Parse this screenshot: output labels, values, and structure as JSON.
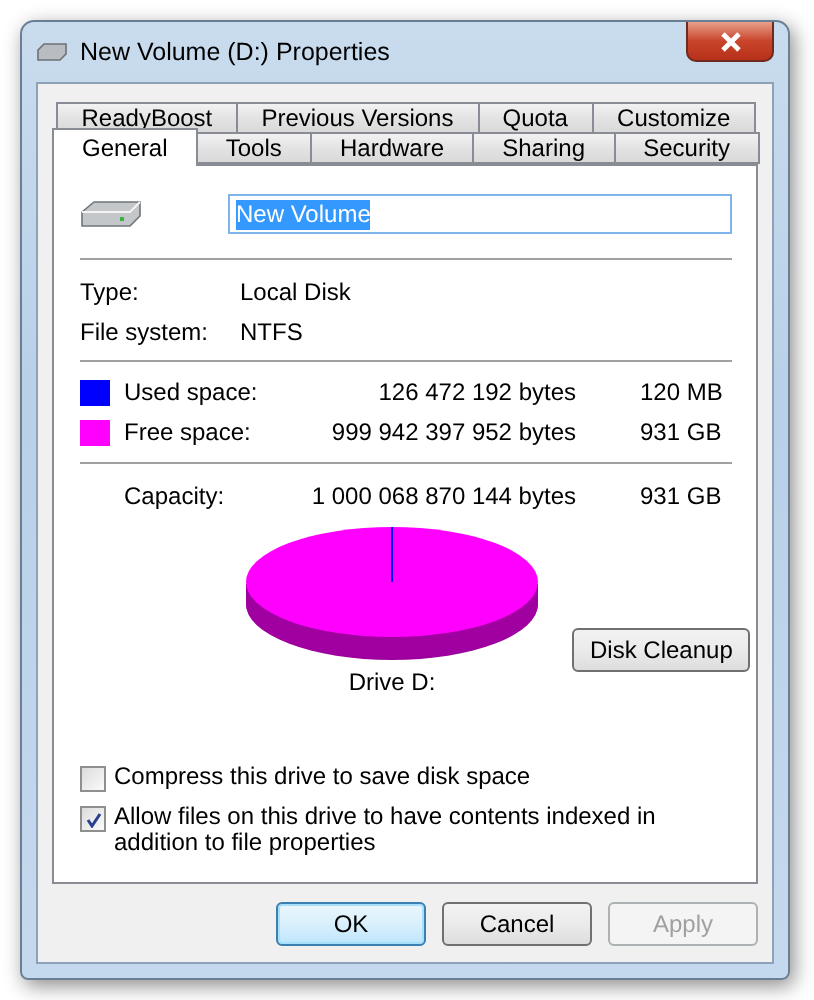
{
  "window": {
    "title": "New Volume (D:) Properties"
  },
  "tab_rows": [
    [
      {
        "label": "ReadyBoost",
        "selected": false
      },
      {
        "label": "Previous Versions",
        "selected": false
      },
      {
        "label": "Quota",
        "selected": false
      },
      {
        "label": "Customize",
        "selected": false
      }
    ],
    [
      {
        "label": "General",
        "selected": true
      },
      {
        "label": "Tools",
        "selected": false
      },
      {
        "label": "Hardware",
        "selected": false
      },
      {
        "label": "Sharing",
        "selected": false
      },
      {
        "label": "Security",
        "selected": false
      }
    ]
  ],
  "name_field": {
    "value": "New Volume",
    "selected": true
  },
  "info": [
    {
      "label": "Type:",
      "value": "Local Disk"
    },
    {
      "label": "File system:",
      "value": "NTFS"
    }
  ],
  "space": [
    {
      "label": "Used space:",
      "bytes": "126 472 192 bytes",
      "size": "120 MB",
      "color": "#0000ff"
    },
    {
      "label": "Free space:",
      "bytes": "999 942 397 952 bytes",
      "size": "931 GB",
      "color": "#ff00ff"
    }
  ],
  "capacity": {
    "label": "Capacity:",
    "bytes": "1 000 068 870 144 bytes",
    "size": "931 GB"
  },
  "drive_label": "Drive D:",
  "cleanup_button": "Disk Cleanup",
  "options": [
    {
      "label": "Compress this drive to save disk space",
      "checked": false
    },
    {
      "label": "Allow files on this drive to have contents indexed in addition to file properties",
      "checked": true
    }
  ],
  "buttons": [
    {
      "label": "OK",
      "disabled": false,
      "default": true
    },
    {
      "label": "Cancel",
      "disabled": false,
      "default": false
    },
    {
      "label": "Apply",
      "disabled": true,
      "default": false
    }
  ]
}
